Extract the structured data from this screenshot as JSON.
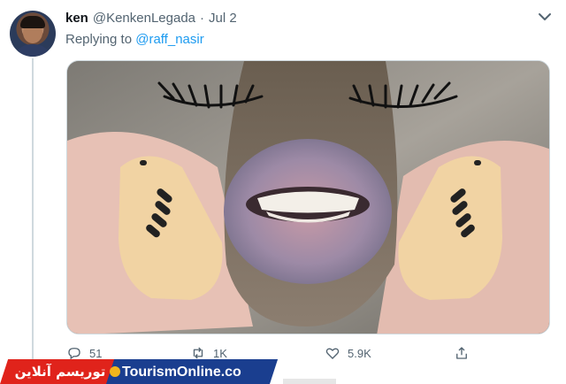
{
  "tweet": {
    "author_name": "ken",
    "author_handle": "@KenkenLegada",
    "separator": "·",
    "date": "Jul 2",
    "replying_prefix": "Replying to",
    "replying_handle": "@raff_nasir"
  },
  "actions": {
    "reply_count": "51",
    "retweet_count": "1K",
    "like_count": "5.9K"
  },
  "icons": {
    "reply": "reply-icon",
    "retweet": "retweet-icon",
    "like": "heart-icon",
    "share": "share-icon",
    "more": "chevron-down-icon"
  },
  "watermark": {
    "persian_text": "توریسم آنلاین",
    "latin_text": "TourismOnline.co"
  },
  "colors": {
    "text_primary": "#0f1419",
    "text_secondary": "#536471",
    "link": "#1d9bf0",
    "banner_red": "#e0231b",
    "banner_blue": "#1a3e8f"
  }
}
